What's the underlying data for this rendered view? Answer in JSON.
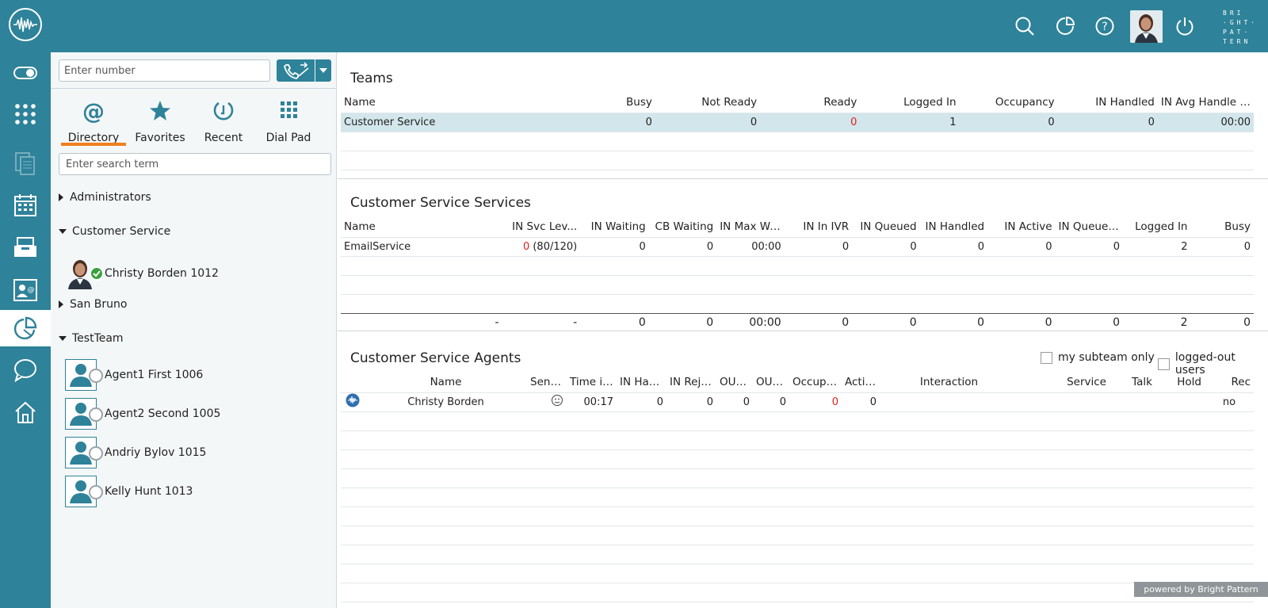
{
  "brand": {
    "lines": "BRI\n·GHT·\nPAT·\nTERN"
  },
  "dial": {
    "placeholder": "Enter number"
  },
  "directory": {
    "tabs": [
      {
        "label": "Directory"
      },
      {
        "label": "Favorites"
      },
      {
        "label": "Recent"
      },
      {
        "label": "Dial Pad"
      }
    ],
    "search_placeholder": "Enter search term",
    "groups": [
      {
        "label": "Administrators",
        "expanded": false
      },
      {
        "label": "Customer Service",
        "expanded": true
      },
      {
        "label": "San Bruno",
        "expanded": false
      },
      {
        "label": "TestTeam",
        "expanded": true
      }
    ],
    "agents": [
      {
        "label": "Christy Borden 1012",
        "status": "ready"
      },
      {
        "label": "Agent1 First 1006",
        "status": "offline"
      },
      {
        "label": "Agent2 Second 1005",
        "status": "offline"
      },
      {
        "label": "Andriy Bylov 1015",
        "status": "offline"
      },
      {
        "label": "Kelly Hunt 1013",
        "status": "offline"
      }
    ]
  },
  "teams": {
    "title": "Teams",
    "columns": [
      "Name",
      "Busy",
      "Not Ready",
      "Ready",
      "Logged In",
      "Occupancy",
      "IN Handled",
      "IN Avg Handle Ti..."
    ],
    "rows": [
      {
        "name": "Customer Service",
        "busy": "0",
        "not_ready": "0",
        "ready": "0",
        "logged_in": "1",
        "occupancy": "0",
        "in_handled": "0",
        "in_avg": "00:00"
      }
    ]
  },
  "services": {
    "title": "Customer Service Services",
    "columns": [
      "Name",
      "IN Svc Lev...",
      "IN Waiting",
      "CB Waiting",
      "IN Max Wait",
      "IN In IVR",
      "IN Queued",
      "IN Handled",
      "IN Active",
      "IN Queue S...",
      "Logged In",
      "Busy"
    ],
    "rows": [
      {
        "name": "EmailService",
        "svc_red": "0",
        "svc_rest": " (80/120)",
        "in_waiting": "0",
        "cb_waiting": "0",
        "max_wait": "00:00",
        "in_ivr": "0",
        "queued": "0",
        "handled": "0",
        "active": "0",
        "queue_s": "0",
        "logged_in": "2",
        "busy": "0"
      }
    ],
    "totals": {
      "c1": "-",
      "c2": "-",
      "in_waiting": "0",
      "cb_waiting": "0",
      "max_wait": "00:00",
      "in_ivr": "0",
      "queued": "0",
      "handled": "0",
      "active": "0",
      "queue_s": "0",
      "logged_in": "2",
      "busy": "0"
    }
  },
  "agents_section": {
    "title": "Customer Service Agents",
    "subteam_label": "my subteam only",
    "loggedout_label": "logged-out users",
    "columns": [
      "Name",
      "Senti...",
      "Time in...",
      "IN Hand...",
      "IN Reje...",
      "OUT...",
      "OUT...",
      "Occupa...",
      "Active",
      "Interaction",
      "Service",
      "Talk",
      "Hold",
      "Rec"
    ],
    "rows": [
      {
        "name": "Christy Borden",
        "time_in": "00:17",
        "in_hand": "0",
        "in_reje": "0",
        "out1": "0",
        "out2": "0",
        "occupa": "0",
        "active": "0",
        "interaction": "",
        "service": "",
        "talk": "",
        "hold": "",
        "rec": "no"
      }
    ]
  },
  "footer": {
    "powered": "powered by Bright Pattern"
  },
  "colors": {
    "brand": "#2e8299",
    "accent": "#f07f1e",
    "alert": "#e02020",
    "selected_row": "#d3e6eb"
  }
}
